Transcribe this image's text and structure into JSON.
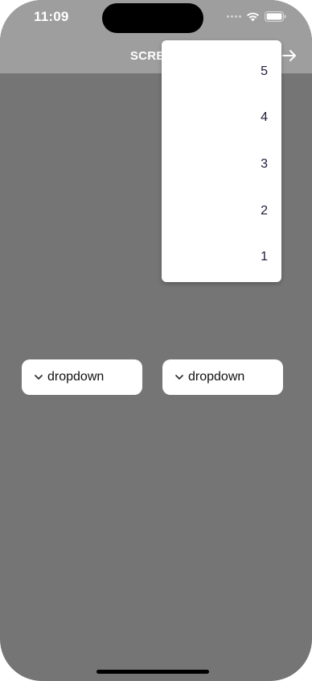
{
  "status_bar": {
    "time": "11:09"
  },
  "appbar": {
    "title": "SCREEN",
    "forward_icon": "arrow-right-icon"
  },
  "dropdowns": [
    {
      "label": "dropdown",
      "icon": "chevron-down-icon"
    },
    {
      "label": "dropdown",
      "icon": "chevron-down-icon"
    }
  ],
  "menu": {
    "items": [
      "5",
      "4",
      "3",
      "2",
      "1"
    ]
  },
  "colors": {
    "scrim": "#757575",
    "appbar": "#9e9e9e",
    "menu_text": "#1c1c3a"
  }
}
